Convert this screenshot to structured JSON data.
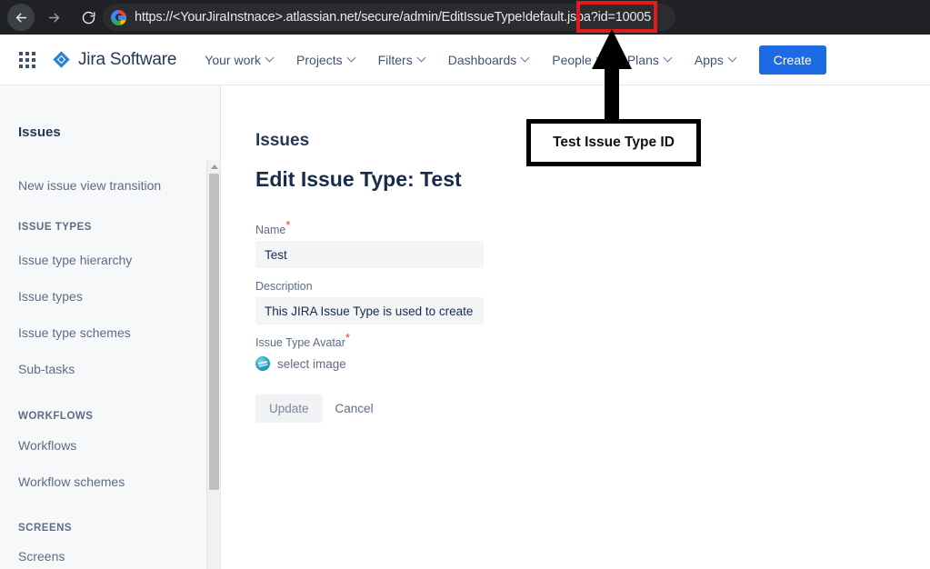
{
  "browser": {
    "back_icon": "back-arrow-icon",
    "forward_icon": "forward-arrow-icon",
    "reload_icon": "reload-icon",
    "favicon": "google-favicon",
    "url_main": "https://<YourJiraInstnace>.atlassian.net/secure/admin/EditIssueType!default.jsp",
    "url_highlighted": "a?id=10005",
    "highlight_color": "#e01b1b"
  },
  "topnav": {
    "apps_grid_icon": "app-switcher-icon",
    "logo_icon": "jira-diamond-icon",
    "brand": "Jira Software",
    "items": [
      {
        "label": "Your work",
        "has_chevron": true
      },
      {
        "label": "Projects",
        "has_chevron": true
      },
      {
        "label": "Filters",
        "has_chevron": true
      },
      {
        "label": "Dashboards",
        "has_chevron": true
      },
      {
        "label": "People",
        "has_chevron": true
      },
      {
        "label": "Plans",
        "has_chevron": true
      },
      {
        "label": "Apps",
        "has_chevron": true
      }
    ],
    "create_label": "Create",
    "create_color": "#1d6ae5"
  },
  "sidebar": {
    "title": "Issues",
    "new_issue_view_transition": "New issue view transition",
    "section_issue_types": "ISSUE TYPES",
    "issue_type_hierarchy": "Issue type hierarchy",
    "issue_types": "Issue types",
    "issue_type_schemes": "Issue type schemes",
    "sub_tasks": "Sub-tasks",
    "section_workflows": "WORKFLOWS",
    "workflows": "Workflows",
    "workflow_schemes": "Workflow schemes",
    "section_screens": "SCREENS",
    "screens": "Screens"
  },
  "main": {
    "subtitle": "Issues",
    "title": "Edit Issue Type: Test",
    "name_label": "Name",
    "name_value": "Test",
    "description_label": "Description",
    "description_value": "This JIRA Issue Type is used to create a",
    "avatar_label": "Issue Type Avatar",
    "avatar_icon": "issue-type-avatar-icon",
    "select_image_label": "select image",
    "update_label": "Update",
    "cancel_label": "Cancel",
    "required_marker": "*"
  },
  "annotation": {
    "callout_text": "Test Issue Type ID",
    "arrow_icon": "up-arrow-annotation"
  }
}
